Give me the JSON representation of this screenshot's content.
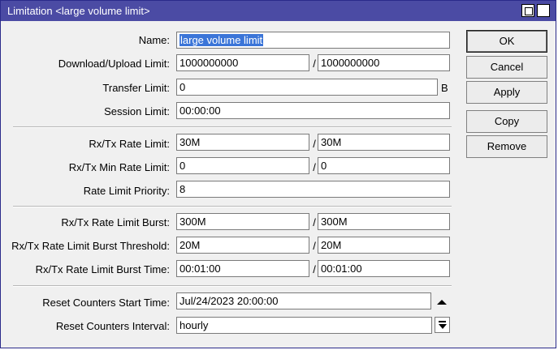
{
  "window": {
    "title": "Limitation <large volume limit>"
  },
  "form": {
    "name": {
      "label": "Name:",
      "value": "large volume limit"
    },
    "download_upload_limit": {
      "label": "Download/Upload Limit:",
      "download": "1000000000",
      "upload": "1000000000"
    },
    "transfer_limit": {
      "label": "Transfer Limit:",
      "value": "0",
      "unit": "B"
    },
    "session_limit": {
      "label": "Session Limit:",
      "value": "00:00:00"
    },
    "rx_tx_rate_limit": {
      "label": "Rx/Tx Rate Limit:",
      "rx": "30M",
      "tx": "30M"
    },
    "rx_tx_min_rate_limit": {
      "label": "Rx/Tx Min Rate Limit:",
      "rx": "0",
      "tx": "0"
    },
    "rate_limit_priority": {
      "label": "Rate Limit Priority:",
      "value": "8"
    },
    "rx_tx_rate_limit_burst": {
      "label": "Rx/Tx Rate Limit Burst:",
      "rx": "300M",
      "tx": "300M"
    },
    "rx_tx_rate_limit_burst_threshold": {
      "label": "Rx/Tx Rate Limit Burst Threshold:",
      "rx": "20M",
      "tx": "20M"
    },
    "rx_tx_rate_limit_burst_time": {
      "label": "Rx/Tx Rate Limit Burst Time:",
      "rx": "00:01:00",
      "tx": "00:01:00"
    },
    "reset_counters_start_time": {
      "label": "Reset Counters Start Time:",
      "value": "Jul/24/2023 20:00:00"
    },
    "reset_counters_interval": {
      "label": "Reset Counters Interval:",
      "value": "hourly"
    },
    "separator": "/"
  },
  "buttons": {
    "ok": "OK",
    "cancel": "Cancel",
    "apply": "Apply",
    "copy": "Copy",
    "remove": "Remove"
  },
  "icons": {
    "restore": "restore-icon",
    "close": "close-icon",
    "collapse": "arrow-up-icon",
    "dropdown": "dropdown-arrow-icon"
  },
  "colors": {
    "titlebar": "#4b4ba4",
    "selection": "#3b75d8"
  }
}
